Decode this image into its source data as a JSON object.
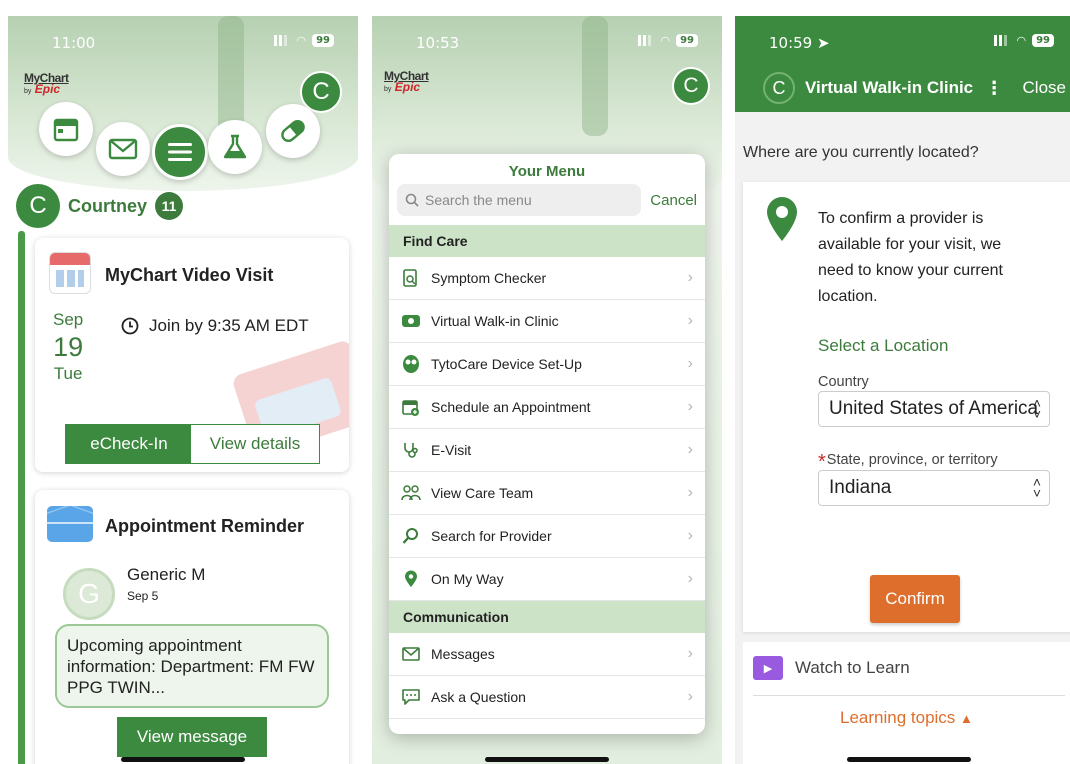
{
  "phone1": {
    "status_time": "11:00",
    "battery": "99",
    "logo_line1": "MyChart",
    "logo_by": "by",
    "logo_epic": "Epic",
    "avatar_letter": "C",
    "user": {
      "initial": "C",
      "name": "Courtney",
      "badge": "11"
    },
    "video_visit": {
      "title": "MyChart Video Visit",
      "month": "Sep",
      "day": "19",
      "weekday": "Tue",
      "join_text": "Join by 9:35 AM EDT",
      "echeckin_label": "eCheck-In",
      "details_label": "View details"
    },
    "reminder": {
      "title": "Appointment Reminder",
      "sender_initial": "G",
      "sender_name": "Generic M",
      "sender_date": "Sep 5",
      "message": "Upcoming appointment information: Department:  FM FW PPG TWIN...",
      "view_label": "View message"
    }
  },
  "phone2": {
    "status_time": "10:53",
    "battery": "99",
    "logo_line1": "MyChart",
    "logo_by": "by",
    "logo_epic": "Epic",
    "avatar_letter": "C",
    "menu_title": "Your Menu",
    "search_placeholder": "Search the menu",
    "cancel_label": "Cancel",
    "sections": [
      {
        "title": "Find Care",
        "items": [
          {
            "label": "Symptom Checker",
            "icon": "symptom-checker-icon"
          },
          {
            "label": "Virtual Walk-in Clinic",
            "icon": "video-icon"
          },
          {
            "label": "TytoCare Device Set-Up",
            "icon": "tytocare-icon"
          },
          {
            "label": "Schedule an Appointment",
            "icon": "calendar-add-icon"
          },
          {
            "label": "E-Visit",
            "icon": "stethoscope-icon"
          },
          {
            "label": "View Care Team",
            "icon": "care-team-icon"
          },
          {
            "label": "Search for Provider",
            "icon": "search-icon"
          },
          {
            "label": "On My Way",
            "icon": "map-pin-icon"
          }
        ]
      },
      {
        "title": "Communication",
        "items": [
          {
            "label": "Messages",
            "icon": "envelope-icon"
          },
          {
            "label": "Ask a Question",
            "icon": "chat-icon"
          }
        ]
      }
    ]
  },
  "phone3": {
    "status_time": "10:59",
    "battery": "99",
    "avatar_letter": "C",
    "title": "Virtual Walk-in Clinic",
    "close_label": "Close",
    "question": "Where are you currently located?",
    "explanation": "To confirm a provider is available for your visit, we need to know your current location.",
    "select_heading": "Select a Location",
    "country_label": "Country",
    "country_value": "United States of America",
    "state_label": "State, province, or territory",
    "state_value": "Indiana",
    "confirm_label": "Confirm",
    "watch_label": "Watch to Learn",
    "topics_label": "Learning topics"
  },
  "colors": {
    "brand_green": "#3c8a3f",
    "section_green": "#cde3c8",
    "confirm_orange": "#dd6e2c",
    "epic_red": "#d0262a"
  }
}
